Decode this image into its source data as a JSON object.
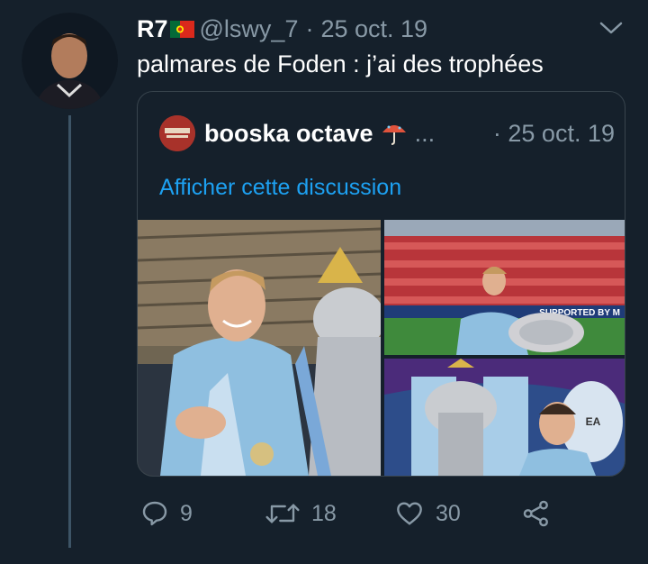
{
  "tweet": {
    "display_name": "R7",
    "handle": "@lswy_7",
    "separator": "·",
    "date": "25 oct. 19",
    "text": "palmares de Foden : j’ai des trophées"
  },
  "quoted": {
    "display_name": "booska octave",
    "ellipsis": "...",
    "date": "· 25 oct. 19",
    "link": "Afficher cette discussion",
    "photo_texts": {
      "banner": "SUPPORTED BY M",
      "sign": "EA"
    }
  },
  "actions": {
    "replies": "9",
    "retweets": "18",
    "likes": "30"
  },
  "colors": {
    "background": "#15202b",
    "muted": "#8899a6",
    "link": "#1da1f2",
    "border": "#38444d"
  },
  "icons": [
    "chevron-down-icon",
    "reply-icon",
    "retweet-icon",
    "like-icon",
    "share-icon",
    "umbrella-icon",
    "portugal-flag-icon"
  ]
}
